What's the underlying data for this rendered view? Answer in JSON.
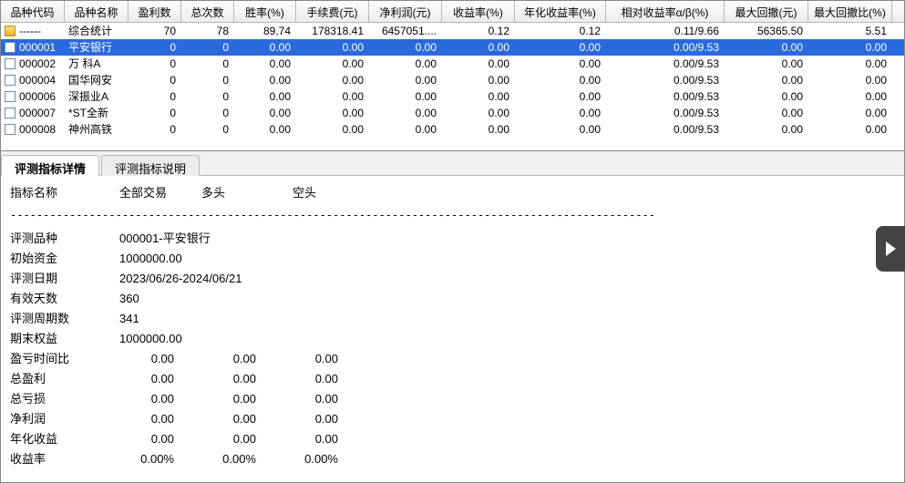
{
  "columns": [
    "品种代码",
    "品种名称",
    "盈利数",
    "总次数",
    "胜率(%)",
    "手续费(元)",
    "净利润(元)",
    "收益率(%)",
    "年化收益率(%)",
    "相对收益率α/β(%)",
    "最大回撤(元)",
    "最大回撤比(%)"
  ],
  "rows": [
    {
      "icon": "folder",
      "code": "------",
      "name": "综合统计",
      "c": [
        "70",
        "78",
        "89.74",
        "178318.41",
        "6457051....",
        "0.12",
        "0.12",
        "0.11/9.66",
        "56365.50",
        "5.51"
      ]
    },
    {
      "icon": "doc",
      "selected": true,
      "code": "000001",
      "name": "平安银行",
      "c": [
        "0",
        "0",
        "0.00",
        "0.00",
        "0.00",
        "0.00",
        "0.00",
        "0.00/9.53",
        "0.00",
        "0.00"
      ]
    },
    {
      "icon": "doc",
      "code": "000002",
      "name": "万 科A",
      "c": [
        "0",
        "0",
        "0.00",
        "0.00",
        "0.00",
        "0.00",
        "0.00",
        "0.00/9.53",
        "0.00",
        "0.00"
      ]
    },
    {
      "icon": "doc",
      "code": "000004",
      "name": "国华网安",
      "c": [
        "0",
        "0",
        "0.00",
        "0.00",
        "0.00",
        "0.00",
        "0.00",
        "0.00/9.53",
        "0.00",
        "0.00"
      ]
    },
    {
      "icon": "doc",
      "code": "000006",
      "name": "深振业A",
      "c": [
        "0",
        "0",
        "0.00",
        "0.00",
        "0.00",
        "0.00",
        "0.00",
        "0.00/9.53",
        "0.00",
        "0.00"
      ]
    },
    {
      "icon": "doc",
      "code": "000007",
      "name": "*ST全新",
      "c": [
        "0",
        "0",
        "0.00",
        "0.00",
        "0.00",
        "0.00",
        "0.00",
        "0.00/9.53",
        "0.00",
        "0.00"
      ]
    },
    {
      "icon": "doc",
      "code": "000008",
      "name": "神州高铁",
      "c": [
        "0",
        "0",
        "0.00",
        "0.00",
        "0.00",
        "0.00",
        "0.00",
        "0.00/9.53",
        "0.00",
        "0.00"
      ]
    }
  ],
  "tabs": {
    "detail": "评测指标详情",
    "explain": "评测指标说明"
  },
  "detail_head": {
    "h0": "指标名称",
    "h1": "全部交易",
    "h2": "多头",
    "h3": "空头"
  },
  "dashes": "--------------------------------------------------------------------------------------------------",
  "detail": {
    "pingce_pinzhong": {
      "k": "评测品种",
      "v": "000001-平安银行"
    },
    "chushi_zijin": {
      "k": "初始资金",
      "v": "1000000.00"
    },
    "pingce_riqi": {
      "k": "评测日期",
      "v": "2023/06/26-2024/06/21"
    },
    "youxiao_tianshu": {
      "k": "有效天数",
      "v": "360"
    },
    "pingce_zhouqi": {
      "k": "评测周期数",
      "v": "341"
    },
    "qimo_quanyi": {
      "k": "期末权益",
      "v": "1000000.00"
    },
    "yingkui_shijian": {
      "k": "盈亏时间比",
      "v1": "0.00",
      "v2": "0.00",
      "v3": "0.00"
    },
    "zong_yingli": {
      "k": "总盈利",
      "v1": "0.00",
      "v2": "0.00",
      "v3": "0.00"
    },
    "zong_kuisun": {
      "k": "总亏损",
      "v1": "0.00",
      "v2": "0.00",
      "v3": "0.00"
    },
    "jing_lirun": {
      "k": "净利润",
      "v1": "0.00",
      "v2": "0.00",
      "v3": "0.00"
    },
    "nianhua_shouyi": {
      "k": "年化收益",
      "v1": "0.00",
      "v2": "0.00",
      "v3": "0.00"
    },
    "shouyi_lv": {
      "k": "收益率",
      "v1": "0.00%",
      "v2": "0.00%",
      "v3": "0.00%"
    }
  }
}
